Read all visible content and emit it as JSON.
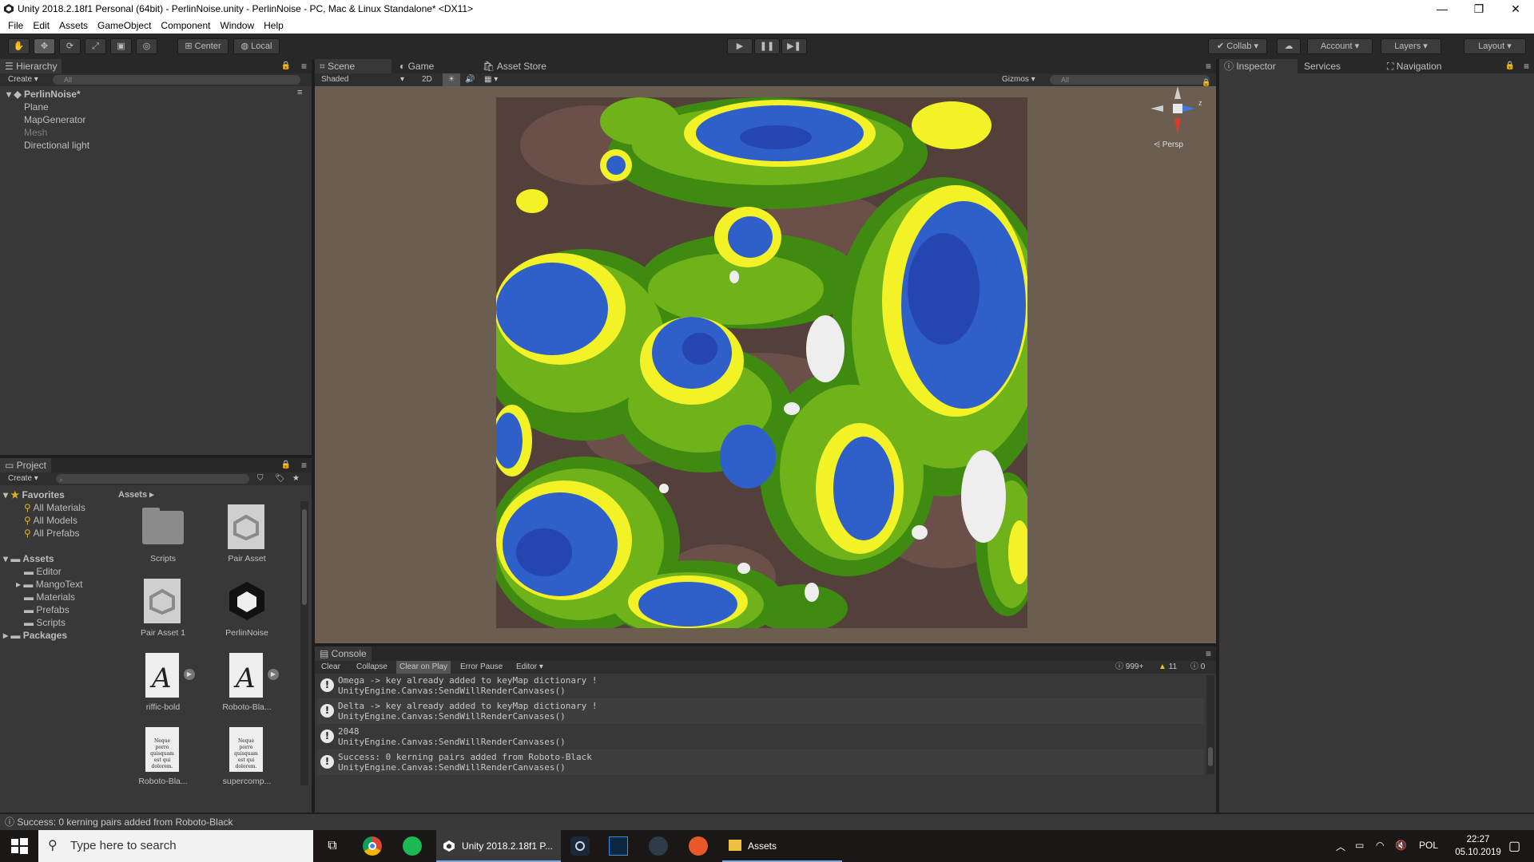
{
  "window": {
    "title": "Unity 2018.2.18f1 Personal (64bit) - PerlinNoise.unity - PerlinNoise - PC, Mac & Linux Standalone* <DX11>",
    "controls": [
      "—",
      "❐",
      "✕"
    ]
  },
  "menu": [
    "File",
    "Edit",
    "Assets",
    "GameObject",
    "Component",
    "Window",
    "Help"
  ],
  "toolbar": {
    "pivot": "Center",
    "space": "Local",
    "collab": "Collab",
    "account": "Account",
    "layers": "Layers",
    "layout": "Layout"
  },
  "hierarchy": {
    "tab": "Hierarchy",
    "create": "Create",
    "search_placeholder": "All",
    "scene": "PerlinNoise*",
    "items": [
      "Plane",
      "MapGenerator",
      "Mesh",
      "Directional light"
    ]
  },
  "scene_view": {
    "tabs": [
      "Scene",
      "Game",
      "Asset Store"
    ],
    "shading": "Shaded",
    "mode_2d": "2D",
    "gizmos": "Gizmos",
    "search_placeholder": "All",
    "persp": "Persp",
    "axis_z": "z"
  },
  "inspector": {
    "tabs": [
      "Inspector",
      "Services",
      "Navigation"
    ]
  },
  "project": {
    "tab": "Project",
    "create": "Create",
    "favorites_label": "Favorites",
    "favorites": [
      "All Materials",
      "All Models",
      "All Prefabs"
    ],
    "assets_label": "Assets",
    "folders": [
      "Editor",
      "MangoText",
      "Materials",
      "Prefabs",
      "Scripts"
    ],
    "packages_label": "Packages",
    "breadcrumb": "Assets",
    "breadcrumb_arrow": "▸",
    "assets": [
      {
        "name": "Scripts",
        "icon": "folder-icon"
      },
      {
        "name": "Pair Asset",
        "icon": "unity-asset-icon"
      },
      {
        "name": "Pair Asset 1",
        "icon": "unity-asset-icon"
      },
      {
        "name": "PerlinNoise",
        "icon": "unity-logo-icon"
      },
      {
        "name": "riffic-bold",
        "icon": "font-icon"
      },
      {
        "name": "Roboto-Bla...",
        "icon": "font-icon"
      },
      {
        "name": "Roboto-Bla...",
        "icon": "font-preview-icon"
      },
      {
        "name": "supercomp...",
        "icon": "font-preview-icon"
      }
    ],
    "font_glyph": "A",
    "font_preview_text": "Neque porro quisquam est qui dolorem."
  },
  "console": {
    "tab": "Console",
    "buttons": [
      "Clear",
      "Collapse",
      "Clear on Play",
      "Error Pause",
      "Editor"
    ],
    "counts": {
      "info": "999+",
      "warn": "11",
      "error": "0"
    },
    "logs": [
      {
        "line1": "Omega -> key already added to keyMap dictionary !",
        "line2": "UnityEngine.Canvas:SendWillRenderCanvases()"
      },
      {
        "line1": "Delta -> key already added to keyMap dictionary !",
        "line2": "UnityEngine.Canvas:SendWillRenderCanvases()"
      },
      {
        "line1": "2048",
        "line2": "UnityEngine.Canvas:SendWillRenderCanvases()"
      },
      {
        "line1": "Success: 0 kerning pairs added from Roboto-Black",
        "line2": "UnityEngine.Canvas:SendWillRenderCanvases()"
      }
    ],
    "log_icon": "!"
  },
  "statusbar": {
    "text": "Success: 0 kerning pairs added from Roboto-Black"
  },
  "taskbar": {
    "search_placeholder": "Type here to search",
    "unity_app": "Unity 2018.2.18f1 P...",
    "explorer_app": "Assets",
    "language": "POL",
    "time": "22:27",
    "date": "05.10.2019"
  },
  "colors": {
    "water": "#2f5fc9",
    "deep_water": "#2546b0",
    "sand": "#f2f227",
    "grass": "#6fb21a",
    "dark_grass": "#3f8a10",
    "dirt": "#54403a",
    "rock": "#6a5048",
    "snow": "#eeeeee"
  }
}
